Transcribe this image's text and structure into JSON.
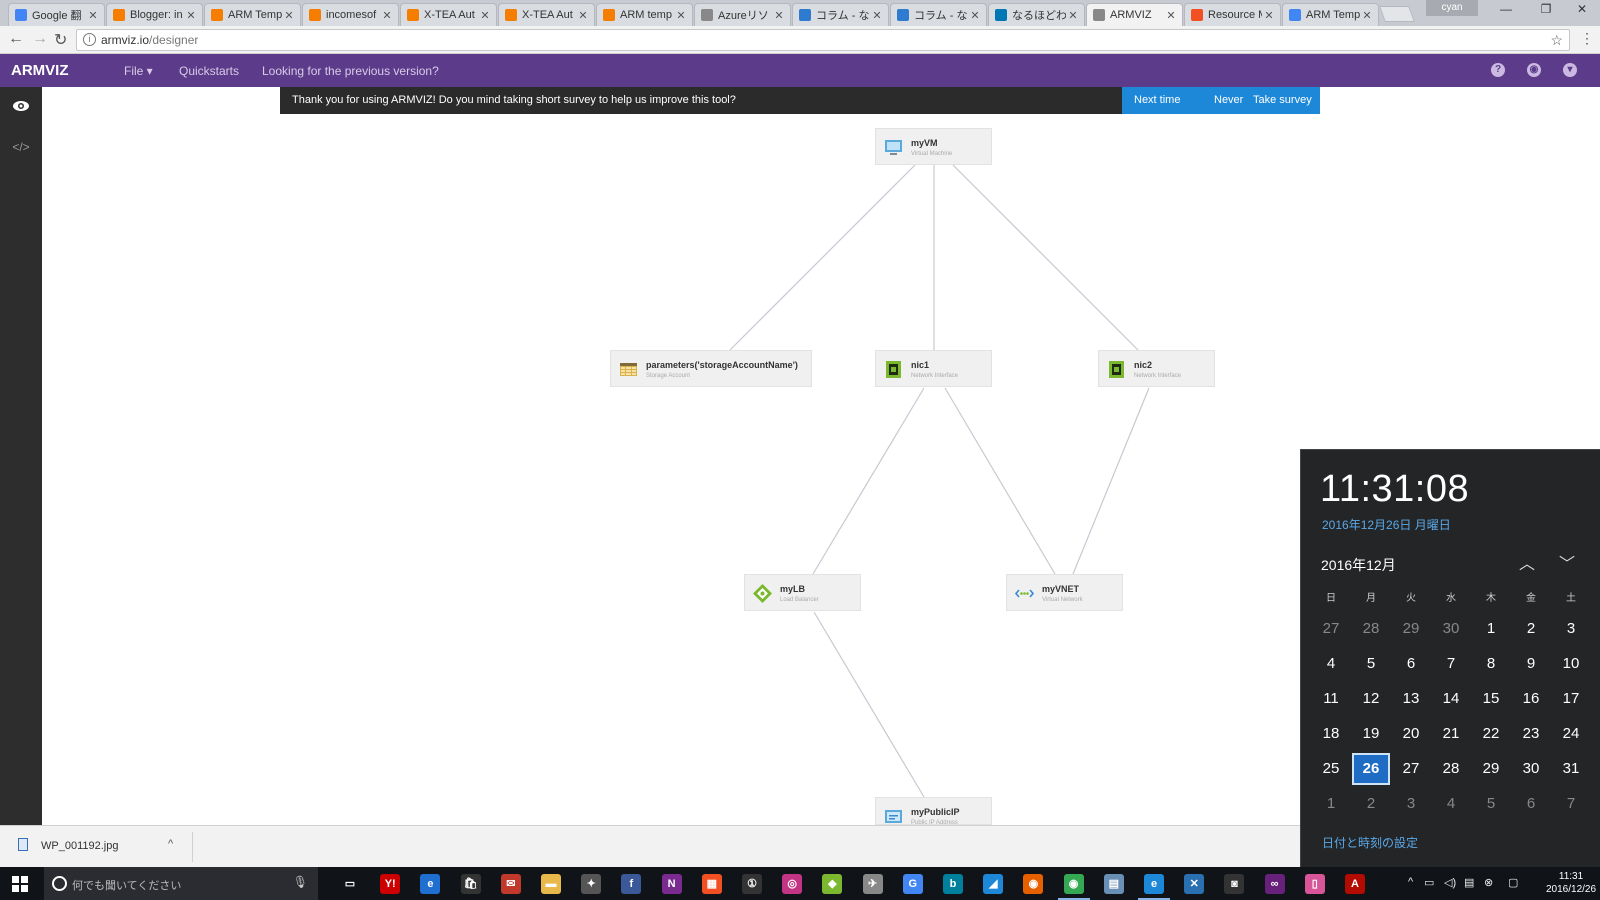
{
  "browser": {
    "tabs": [
      {
        "label": "Google 翻",
        "favicon": "google-icon",
        "color": "#4285f4"
      },
      {
        "label": "Blogger: in",
        "favicon": "blogger-icon",
        "color": "#f57d00"
      },
      {
        "label": "ARM Temp",
        "favicon": "blogger-icon",
        "color": "#f57d00"
      },
      {
        "label": "incomesof",
        "favicon": "blogger-icon",
        "color": "#f57d00"
      },
      {
        "label": "X-TEA Aut",
        "favicon": "blogger-icon",
        "color": "#f57d00"
      },
      {
        "label": "X-TEA Aut",
        "favicon": "blogger-icon",
        "color": "#f57d00"
      },
      {
        "label": "ARM temp",
        "favicon": "blogger-icon",
        "color": "#f57d00"
      },
      {
        "label": "Azureリソ",
        "favicon": "page-icon",
        "color": "#888888"
      },
      {
        "label": "コラム - なる",
        "favicon": "globe-icon",
        "color": "#2e7bcf"
      },
      {
        "label": "コラム - なる",
        "favicon": "globe-icon",
        "color": "#2e7bcf"
      },
      {
        "label": "なるほどわか",
        "favicon": "linkedin-icon",
        "color": "#0077b5"
      },
      {
        "label": "ARMVIZ",
        "favicon": "page-icon",
        "color": "#888888",
        "active": true
      },
      {
        "label": "Resource M",
        "favicon": "microsoft-icon",
        "color": "#f25022"
      },
      {
        "label": "ARM Temp",
        "favicon": "google-icon",
        "color": "#4285f4"
      }
    ],
    "profile_name": "cyan",
    "url_host": "armviz.io",
    "url_path": "/designer"
  },
  "navbar": {
    "brand": "ARMVIZ",
    "file_label": "File ▾",
    "quickstarts_label": "Quickstarts",
    "previous_label": "Looking for the previous version?"
  },
  "survey": {
    "message": "Thank you for using ARMVIZ! Do you mind taking short survey to help us improve this tool?",
    "next_time": "Next time",
    "never": "Never",
    "take_survey": "Take survey"
  },
  "nodes": {
    "myvm": {
      "title": "myVM",
      "type": "Virtual Machine"
    },
    "storage": {
      "title": "parameters('storageAccountName')",
      "type": "Storage Account"
    },
    "nic1": {
      "title": "nic1",
      "type": "Network Interface"
    },
    "nic2": {
      "title": "nic2",
      "type": "Network Interface"
    },
    "mylb": {
      "title": "myLB",
      "type": "Load Balancer"
    },
    "myvnet": {
      "title": "myVNET",
      "type": "Virtual Network"
    },
    "mypublicip": {
      "title": "myPublicIP",
      "type": "Public IP Address"
    }
  },
  "download": {
    "filename": "WP_001192.jpg"
  },
  "calendar": {
    "time": "11:31:08",
    "date": "2016年12月26日 月曜日",
    "month": "2016年12月",
    "weekdays": [
      "日",
      "月",
      "火",
      "水",
      "木",
      "金",
      "土"
    ],
    "days": [
      [
        "27",
        "28",
        "29",
        "30",
        "1",
        "2",
        "3"
      ],
      [
        "4",
        "5",
        "6",
        "7",
        "8",
        "9",
        "10"
      ],
      [
        "11",
        "12",
        "13",
        "14",
        "15",
        "16",
        "17"
      ],
      [
        "18",
        "19",
        "20",
        "21",
        "22",
        "23",
        "24"
      ],
      [
        "25",
        "26",
        "27",
        "28",
        "29",
        "30",
        "31"
      ],
      [
        "1",
        "2",
        "3",
        "4",
        "5",
        "6",
        "7"
      ]
    ],
    "today": "26",
    "settings_link": "日付と時刻の設定"
  },
  "taskbar": {
    "search_placeholder": "何でも聞いてください",
    "clock_time": "11:31",
    "clock_date": "2016/12/26"
  },
  "colors": {
    "navbar": "#5c3c8a",
    "survey_buttons": "#1e88d8",
    "today": "#1f6cc4"
  }
}
